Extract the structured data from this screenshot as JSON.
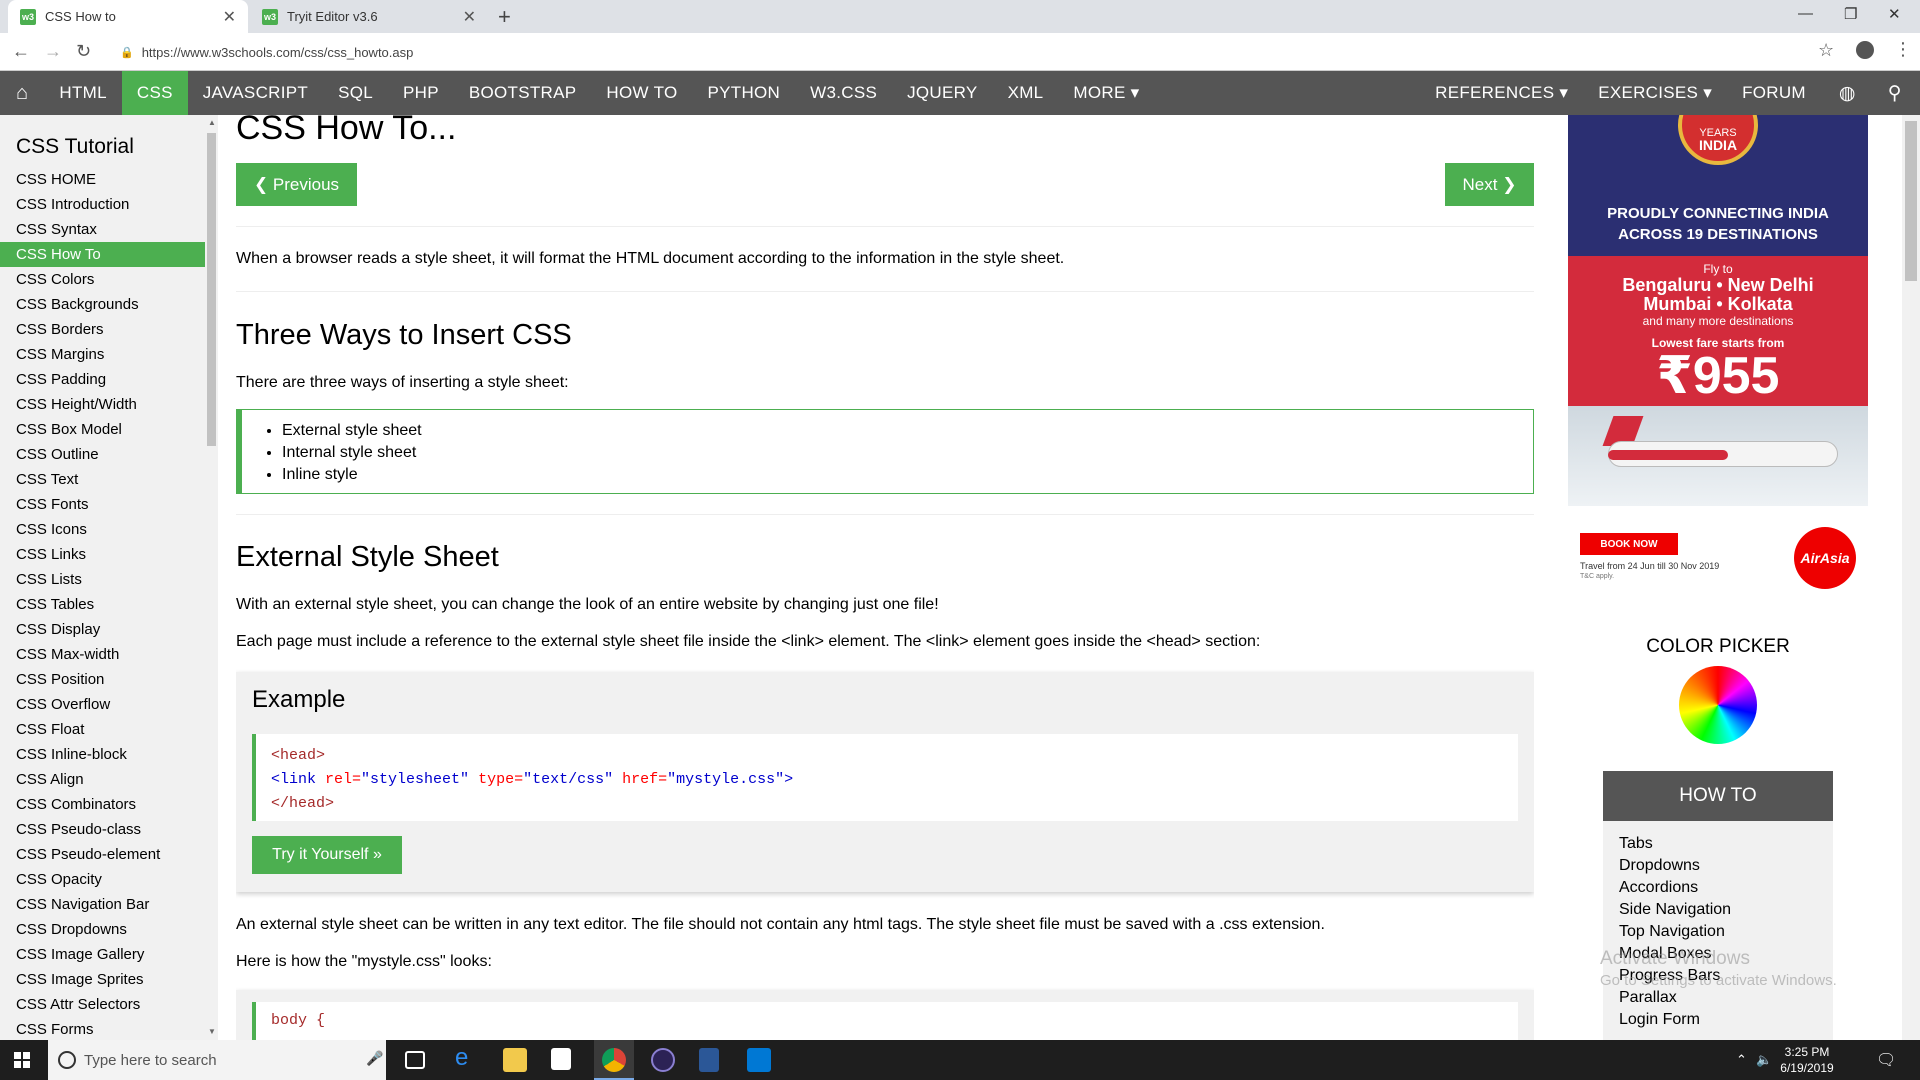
{
  "browser": {
    "tabs": [
      {
        "label": "CSS How to",
        "active": true
      },
      {
        "label": "Tryit Editor v3.6",
        "active": false
      }
    ],
    "favicon_text": "w3",
    "url": "https://www.w3schools.com/css/css_howto.asp"
  },
  "topnav": {
    "left": [
      "HTML",
      "CSS",
      "JAVASCRIPT",
      "SQL",
      "PHP",
      "BOOTSTRAP",
      "HOW TO",
      "PYTHON",
      "W3.CSS",
      "JQUERY",
      "XML",
      "MORE ▾"
    ],
    "active": "CSS",
    "right": [
      "REFERENCES ▾",
      "EXERCISES ▾",
      "FORUM"
    ]
  },
  "sidebar": {
    "title": "CSS Tutorial",
    "items": [
      "CSS HOME",
      "CSS Introduction",
      "CSS Syntax",
      "CSS How To",
      "CSS Colors",
      "CSS Backgrounds",
      "CSS Borders",
      "CSS Margins",
      "CSS Padding",
      "CSS Height/Width",
      "CSS Box Model",
      "CSS Outline",
      "CSS Text",
      "CSS Fonts",
      "CSS Icons",
      "CSS Links",
      "CSS Lists",
      "CSS Tables",
      "CSS Display",
      "CSS Max-width",
      "CSS Position",
      "CSS Overflow",
      "CSS Float",
      "CSS Inline-block",
      "CSS Align",
      "CSS Combinators",
      "CSS Pseudo-class",
      "CSS Pseudo-element",
      "CSS Opacity",
      "CSS Navigation Bar",
      "CSS Dropdowns",
      "CSS Image Gallery",
      "CSS Image Sprites",
      "CSS Attr Selectors",
      "CSS Forms"
    ],
    "active_index": 3
  },
  "main": {
    "title": "CSS How To...",
    "prev_label": "❮ Previous",
    "next_label": "Next ❯",
    "intro": "When a browser reads a style sheet, it will format the HTML document according to the information in the style sheet.",
    "h_three": "Three Ways to Insert CSS",
    "three_text": "There are three ways of inserting a style sheet:",
    "ways": [
      "External style sheet",
      "Internal style sheet",
      "Inline style"
    ],
    "h_external": "External Style Sheet",
    "ext_p1": "With an external style sheet, you can change the look of an entire website by changing just one file!",
    "ext_p2": "Each page must include a reference to the external style sheet file inside the <link> element. The <link> element goes inside the <head> section:",
    "example_title": "Example",
    "code": {
      "line1": "<head>",
      "link_open": "<link",
      "rel_attr": " rel=",
      "rel_val": "\"stylesheet\"",
      "type_attr": " type=",
      "type_val": "\"text/css\"",
      "href_attr": " href=",
      "href_val": "\"mystyle.css\"",
      "link_close": ">",
      "line3": "</head>"
    },
    "try_label": "Try it Yourself »",
    "ext_p3": "An external style sheet can be written in any text editor. The file should not contain any html tags. The style sheet file must be saved with a .css extension.",
    "ext_p4": "Here is how the \"mystyle.css\" looks:",
    "code2_line": "body {"
  },
  "ad": {
    "years": "YEARS",
    "country": "INDIA",
    "headline1": "PROUDLY CONNECTING INDIA",
    "headline2": "ACROSS 19 DESTINATIONS",
    "fly_to": "Fly to",
    "cities1": "Bengaluru • New Delhi",
    "cities2": "Mumbai • Kolkata",
    "more": "and many more destinations",
    "fare": "Lowest fare starts from",
    "price": "₹955",
    "book": "BOOK NOW",
    "travel": "Travel from 24 Jun till 30 Nov 2019",
    "tnc": "T&C apply.",
    "brand": "AirAsia"
  },
  "color_picker": {
    "title": "COLOR PICKER"
  },
  "howto": {
    "header": "HOW TO",
    "items": [
      "Tabs",
      "Dropdowns",
      "Accordions",
      "Side Navigation",
      "Top Navigation",
      "Modal Boxes",
      "Progress Bars",
      "Parallax",
      "Login Form"
    ]
  },
  "watermark": {
    "line1": "Activate Windows",
    "line2": "Go to Settings to activate Windows."
  },
  "taskbar": {
    "search_placeholder": "Type here to search",
    "time": "3:25 PM",
    "date": "6/19/2019"
  }
}
